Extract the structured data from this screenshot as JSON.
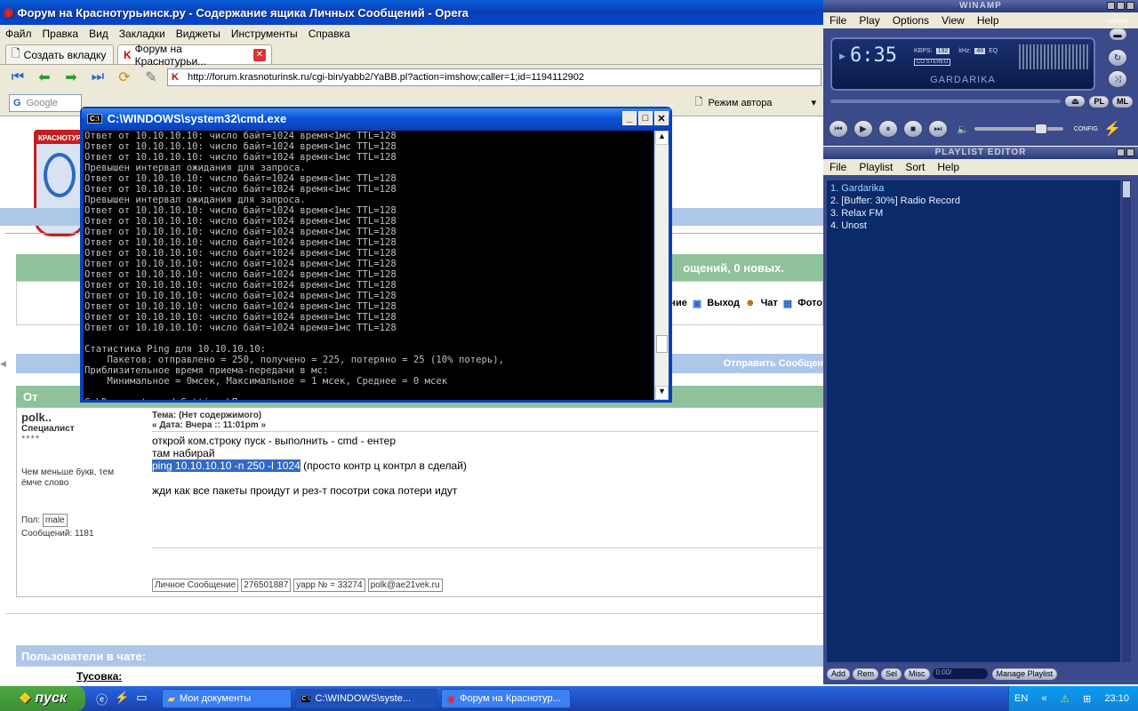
{
  "opera": {
    "title": "Форум на Краснотурьинск.ру - Содержание ящика Личных Сообщений - Opera",
    "menu": [
      "Файл",
      "Правка",
      "Вид",
      "Закладки",
      "Виджеты",
      "Инструменты",
      "Справка"
    ],
    "tabs": [
      "Создать вкладку",
      "Форум на Краснотурьи..."
    ],
    "url": "http://forum.krasnoturinsk.ru/cgi-bin/yabb2/YaBB.pl?action=imshow;caller=1;id=1194112902",
    "search_placeholder": "Google",
    "author_mode": "Режим автора"
  },
  "forum": {
    "logo_text": "КРАСНОТУР",
    "msg_count": "ощений, 0 новых.",
    "nav": [
      "ние",
      "Выход",
      "Чат",
      "Фото"
    ],
    "send_message": "Отправить Сообщен",
    "from_header": "От",
    "author": "polk..",
    "rank": "Специалист",
    "stars": "****",
    "signature": "Чем меньше букв, тем ёмче слово",
    "gender_label": "Пол:",
    "gender": "male",
    "posts_label": "Сообщений: 1181",
    "subject": "Тема: (Нет содержимого)",
    "date": "« Дата: Вчера :: 11:01pm »",
    "body1": "открой ком.строку пуск - выполнить - cmd - ентер",
    "body2": "там набирай",
    "body3_hl": "ping 10.10.10.10 -n 250 -l 1024",
    "body3_rest": " (просто контр ц контрл в сделай)",
    "body4": "жди как все пакеты проидут и рез-т посотри сока потери идут",
    "contacts": [
      "Личное Сообщение",
      "276501887",
      "уарр № = 33274",
      "polk@ae21vek.ru"
    ],
    "chat_users": "Пользователи в чате:",
    "tusovka": "Тусовка:"
  },
  "cmd": {
    "title": "C:\\WINDOWS\\system32\\cmd.exe",
    "text": "Ответ от 10.10.10.10: число байт=1024 время<1мс TTL=128\nОтвет от 10.10.10.10: число байт=1024 время<1мс TTL=128\nОтвет от 10.10.10.10: число байт=1024 время<1мс TTL=128\nПревышен интервал ожидания для запроса.\nОтвет от 10.10.10.10: число байт=1024 время<1мс TTL=128\nОтвет от 10.10.10.10: число байт=1024 время<1мс TTL=128\nПревышен интервал ожидания для запроса.\nОтвет от 10.10.10.10: число байт=1024 время<1мс TTL=128\nОтвет от 10.10.10.10: число байт=1024 время<1мс TTL=128\nОтвет от 10.10.10.10: число байт=1024 время<1мс TTL=128\nОтвет от 10.10.10.10: число байт=1024 время<1мс TTL=128\nОтвет от 10.10.10.10: число байт=1024 время<1мс TTL=128\nОтвет от 10.10.10.10: число байт=1024 время<1мс TTL=128\nОтвет от 10.10.10.10: число байт=1024 время<1мс TTL=128\nОтвет от 10.10.10.10: число байт=1024 время<1мс TTL=128\nОтвет от 10.10.10.10: число байт=1024 время<1мс TTL=128\nОтвет от 10.10.10.10: число байт=1024 время<1мс TTL=128\nОтвет от 10.10.10.10: число байт=1024 время=1мс TTL=128\nОтвет от 10.10.10.10: число байт=1024 время=1мс TTL=128\n\nСтатистика Ping для 10.10.10.10:\n    Пакетов: отправлено = 250, получено = 225, потеряно = 25 (10% потерь),\nПриблизительное время приема-передачи в мс:\n    Минимальное = 0мсек, Максимальное = 1 мсек, Среднее = 0 мсек\n\nC:\\Documents and Settings\\Пользователь>"
  },
  "winamp": {
    "title": "WINAMP",
    "menu": [
      "File",
      "Play",
      "Options",
      "View",
      "Help"
    ],
    "time": "6:35",
    "kbps_label": "KBPS:",
    "kbps": "192",
    "khz_label": "kHz:",
    "khz": "48",
    "eq": "EQ",
    "stereo": "CO STEREO",
    "track": "GARDARIKA",
    "video_vis": "VIDEO/VIS",
    "pl": "PL",
    "ml": "ML",
    "config": "CONFIG"
  },
  "playlist": {
    "title": "PLAYLIST EDITOR",
    "menu": [
      "File",
      "Playlist",
      "Sort",
      "Help"
    ],
    "items": [
      "1. Gardarika",
      "2. [Buffer: 30%] Radio Record",
      "3. Relax FM",
      "4. Unost"
    ],
    "buttons": [
      "Add",
      "Rem",
      "Sel",
      "Misc"
    ],
    "time": "0:00/",
    "manage": "Manage Playlist"
  },
  "taskbar": {
    "start": "пуск",
    "tasks": [
      "Мои документы",
      "C:\\WINDOWS\\syste...",
      "Форум на Краснотур..."
    ],
    "lang": "EN",
    "clock": "23:10"
  }
}
